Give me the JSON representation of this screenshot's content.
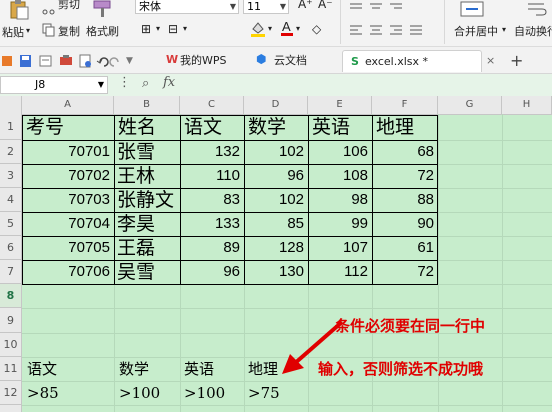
{
  "ribbon": {
    "cut": "剪切",
    "paste": "粘贴",
    "copy": "复制",
    "format_painter": "格式刷",
    "font_name": "宋体",
    "font_size": "11",
    "merge_center": "合并居中",
    "wrap": "自动换行"
  },
  "tabs": [
    {
      "label": "我的WPS"
    },
    {
      "label": "云文档"
    },
    {
      "label": "excel.xlsx *"
    }
  ],
  "formula_bar": {
    "cell_ref": "J8",
    "fx": "fx",
    "value": ""
  },
  "columns": [
    "A",
    "B",
    "C",
    "D",
    "E",
    "F",
    "G",
    "H"
  ],
  "rows": [
    "1",
    "2",
    "3",
    "4",
    "5",
    "6",
    "7",
    "8",
    "9",
    "10",
    "11",
    "12"
  ],
  "selected_row": "8",
  "table": {
    "headers": [
      "考号",
      "姓名",
      "语文",
      "数学",
      "英语",
      "地理"
    ],
    "rows": [
      [
        "70701",
        "张雪",
        "132",
        "102",
        "106",
        "68"
      ],
      [
        "70702",
        "王林",
        "110",
        "96",
        "108",
        "72"
      ],
      [
        "70703",
        "张静文",
        "83",
        "102",
        "98",
        "88"
      ],
      [
        "70704",
        "李昊",
        "133",
        "85",
        "99",
        "90"
      ],
      [
        "70705",
        "王磊",
        "89",
        "128",
        "107",
        "61"
      ],
      [
        "70706",
        "吴雪",
        "96",
        "130",
        "112",
        "72"
      ]
    ]
  },
  "criteria": {
    "headers": [
      "语文",
      "数学",
      "英语",
      "地理"
    ],
    "values": [
      ">85",
      ">100",
      ">100",
      ">75"
    ]
  },
  "annotation": {
    "line1": "条件必须要在同一行中",
    "line2": "输入，否则筛选不成功哦"
  },
  "colors": {
    "sheet_bg": "#c7edcc",
    "annotation": "#e00000"
  }
}
